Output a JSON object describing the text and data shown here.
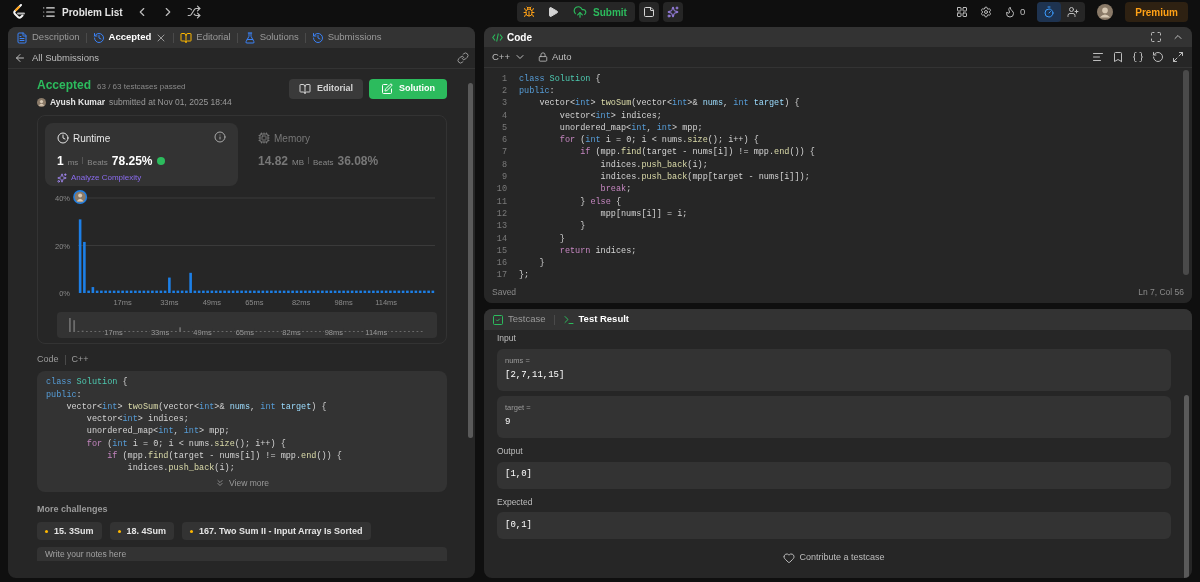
{
  "top_bar": {
    "title": "Problem List",
    "submit": "Submit",
    "streak": "0",
    "premium": "Premium"
  },
  "left_panel": {
    "tabs": [
      {
        "label": "Description",
        "selected": false,
        "closable": false
      },
      {
        "label": "Accepted",
        "selected": true,
        "closable": true
      },
      {
        "label": "Editorial",
        "selected": false,
        "closable": false
      },
      {
        "label": "Solutions",
        "selected": false,
        "closable": false
      },
      {
        "label": "Submissions",
        "selected": false,
        "closable": false
      }
    ],
    "back_link": "All Submissions",
    "status": "Accepted",
    "testcases": "63 / 63 testcases passed",
    "author": "Ayush Kumar",
    "submitted": "submitted at Nov 01, 2025 18:44",
    "editorial_button": "Editorial",
    "solution_button": "Solution",
    "runtime": {
      "title": "Runtime",
      "value": "1",
      "unit": "ms",
      "beats_label": "Beats",
      "beats": "78.25%",
      "analyze": "Analyze Complexity",
      "selected": true
    },
    "memory": {
      "title": "Memory",
      "value": "14.82",
      "unit": "MB",
      "beats_label": "Beats",
      "beats": "36.08%",
      "selected": false
    },
    "chart_data": {
      "type": "bar",
      "ylim": [
        0,
        40
      ],
      "yticks": [
        {
          "value": 0,
          "label": "0%"
        },
        {
          "value": 20,
          "label": "20%"
        },
        {
          "value": 40,
          "label": "40%"
        }
      ],
      "categories": [
        null,
        null,
        null,
        null,
        null,
        null,
        null,
        null,
        null,
        null,
        "17ms",
        null,
        null,
        null,
        null,
        null,
        null,
        null,
        null,
        null,
        null,
        "33ms",
        null,
        null,
        null,
        null,
        null,
        null,
        null,
        null,
        null,
        "49ms",
        null,
        null,
        null,
        null,
        null,
        null,
        null,
        null,
        null,
        "65ms",
        null,
        null,
        null,
        null,
        null,
        null,
        null,
        null,
        null,
        null,
        "82ms",
        null,
        null,
        null,
        null,
        null,
        null,
        null,
        null,
        null,
        "98ms",
        null,
        null,
        null,
        null,
        null,
        null,
        null,
        null,
        null,
        "114ms",
        null,
        null,
        null,
        null,
        null,
        null,
        null,
        null,
        null,
        null,
        null
      ],
      "values": [
        31,
        21.5,
        1,
        2.5,
        1,
        1,
        1,
        1,
        1,
        1,
        1,
        1,
        1,
        1,
        1,
        1,
        1,
        1,
        1,
        1,
        1,
        6.5,
        1,
        1,
        1,
        1,
        8.5,
        1,
        1,
        1,
        1,
        1,
        1,
        1,
        1,
        1,
        1,
        1,
        1,
        1,
        1,
        1,
        1,
        1,
        1,
        1,
        1,
        1,
        1,
        1,
        1,
        1,
        1,
        1,
        1,
        1,
        1,
        1,
        1,
        1,
        1,
        1,
        1,
        1,
        1,
        1,
        1,
        1,
        1,
        1,
        1,
        1,
        1,
        1,
        1,
        1,
        1,
        1,
        1,
        1,
        1,
        1,
        1,
        1
      ]
    },
    "brush_labels": [
      "17ms",
      "33ms",
      "49ms",
      "65ms",
      "82ms",
      "98ms",
      "114ms"
    ],
    "code_label": "Code",
    "language": "C++",
    "code_lines": [
      [
        {
          "text": "class ",
          "kind": "k"
        },
        {
          "text": "Solution",
          "kind": "t"
        },
        {
          "text": " {",
          "kind": "p"
        }
      ],
      [
        {
          "text": "public",
          "kind": "k"
        },
        {
          "text": ":",
          "kind": "p"
        }
      ],
      [
        {
          "text": "    vector<",
          "kind": "p"
        },
        {
          "text": "int",
          "kind": "k"
        },
        {
          "text": "> ",
          "kind": "p"
        },
        {
          "text": "twoSum",
          "kind": "f"
        },
        {
          "text": "(vector<",
          "kind": "p"
        },
        {
          "text": "int",
          "kind": "k"
        },
        {
          "text": ">& ",
          "kind": "p"
        },
        {
          "text": "nums",
          "kind": "v"
        },
        {
          "text": ", ",
          "kind": "p"
        },
        {
          "text": "int ",
          "kind": "k"
        },
        {
          "text": "target",
          "kind": "v"
        },
        {
          "text": ") {",
          "kind": "p"
        }
      ],
      [
        {
          "text": "        vector<",
          "kind": "p"
        },
        {
          "text": "int",
          "kind": "k"
        },
        {
          "text": "> indices;",
          "kind": "p"
        }
      ],
      [
        {
          "text": "        unordered_map<",
          "kind": "p"
        },
        {
          "text": "int",
          "kind": "k"
        },
        {
          "text": ", ",
          "kind": "p"
        },
        {
          "text": "int",
          "kind": "k"
        },
        {
          "text": "> mpp;",
          "kind": "p"
        }
      ],
      [
        {
          "text": "        for",
          "kind": "c"
        },
        {
          "text": " (",
          "kind": "p"
        },
        {
          "text": "int",
          "kind": "k"
        },
        {
          "text": " i = 0; i < nums.",
          "kind": "p"
        },
        {
          "text": "size",
          "kind": "f"
        },
        {
          "text": "(); i++) {",
          "kind": "p"
        }
      ],
      [
        {
          "text": "            if",
          "kind": "c"
        },
        {
          "text": " (mpp.",
          "kind": "p"
        },
        {
          "text": "find",
          "kind": "f"
        },
        {
          "text": "(target - nums[i]) != mpp.",
          "kind": "p"
        },
        {
          "text": "end",
          "kind": "f"
        },
        {
          "text": "()) {",
          "kind": "p"
        }
      ],
      [
        {
          "text": "                indices.",
          "kind": "p"
        },
        {
          "text": "push_back",
          "kind": "f"
        },
        {
          "text": "(i);",
          "kind": "p"
        }
      ]
    ],
    "view_more": "View more",
    "more_challenges": "More challenges",
    "challenges": [
      {
        "label": "15. 3Sum",
        "color": "#ffb800"
      },
      {
        "label": "18. 4Sum",
        "color": "#ffb800"
      },
      {
        "label": "167. Two Sum II - Input Array Is Sorted",
        "color": "#ffb800"
      }
    ],
    "notes_placeholder": "Write your notes here"
  },
  "code_panel": {
    "title": "Code",
    "language": "C++",
    "mode": "Auto",
    "lines": [
      {
        "n": "1",
        "tokens": [
          {
            "text": "class ",
            "kind": "k"
          },
          {
            "text": "Solution",
            "kind": "t"
          },
          {
            "text": " {",
            "kind": "p"
          }
        ]
      },
      {
        "n": "2",
        "tokens": [
          {
            "text": "public",
            "kind": "k"
          },
          {
            "text": ":",
            "kind": "p"
          }
        ]
      },
      {
        "n": "3",
        "tokens": [
          {
            "text": "    vector<",
            "kind": "p"
          },
          {
            "text": "int",
            "kind": "k"
          },
          {
            "text": "> ",
            "kind": "p"
          },
          {
            "text": "twoSum",
            "kind": "f"
          },
          {
            "text": "(vector<",
            "kind": "p"
          },
          {
            "text": "int",
            "kind": "k"
          },
          {
            "text": ">& ",
            "kind": "p"
          },
          {
            "text": "nums",
            "kind": "v"
          },
          {
            "text": ", ",
            "kind": "p"
          },
          {
            "text": "int ",
            "kind": "k"
          },
          {
            "text": "target",
            "kind": "v"
          },
          {
            "text": ") {",
            "kind": "p"
          }
        ]
      },
      {
        "n": "4",
        "tokens": [
          {
            "text": "        vector<",
            "kind": "p"
          },
          {
            "text": "int",
            "kind": "k"
          },
          {
            "text": "> indices;",
            "kind": "p"
          }
        ]
      },
      {
        "n": "5",
        "tokens": [
          {
            "text": "        unordered_map<",
            "kind": "p"
          },
          {
            "text": "int",
            "kind": "k"
          },
          {
            "text": ", ",
            "kind": "p"
          },
          {
            "text": "int",
            "kind": "k"
          },
          {
            "text": "> mpp;",
            "kind": "p"
          }
        ]
      },
      {
        "n": "6",
        "tokens": [
          {
            "text": "        for",
            "kind": "c"
          },
          {
            "text": " (",
            "kind": "p"
          },
          {
            "text": "int",
            "kind": "k"
          },
          {
            "text": " i = 0; i < nums.",
            "kind": "p"
          },
          {
            "text": "size",
            "kind": "f"
          },
          {
            "text": "(); i++) {",
            "kind": "p"
          }
        ]
      },
      {
        "n": "7",
        "tokens": [
          {
            "text": "            if",
            "kind": "c"
          },
          {
            "text": " (mpp.",
            "kind": "p"
          },
          {
            "text": "find",
            "kind": "f"
          },
          {
            "text": "(target - nums[i]) != mpp.",
            "kind": "p"
          },
          {
            "text": "end",
            "kind": "f"
          },
          {
            "text": "()) {",
            "kind": "p"
          }
        ]
      },
      {
        "n": "8",
        "tokens": [
          {
            "text": "                indices.",
            "kind": "p"
          },
          {
            "text": "push_back",
            "kind": "f"
          },
          {
            "text": "(i);",
            "kind": "p"
          }
        ]
      },
      {
        "n": "9",
        "tokens": [
          {
            "text": "                indices.",
            "kind": "p"
          },
          {
            "text": "push_back",
            "kind": "f"
          },
          {
            "text": "(mpp[target - nums[i]]);",
            "kind": "p"
          }
        ]
      },
      {
        "n": "10",
        "tokens": [
          {
            "text": "                break",
            "kind": "c"
          },
          {
            "text": ";",
            "kind": "p"
          }
        ]
      },
      {
        "n": "11",
        "tokens": [
          {
            "text": "            } ",
            "kind": "p"
          },
          {
            "text": "else",
            "kind": "c"
          },
          {
            "text": " {",
            "kind": "p"
          }
        ]
      },
      {
        "n": "12",
        "tokens": [
          {
            "text": "                mpp[nums[i]] = i;",
            "kind": "p"
          }
        ]
      },
      {
        "n": "13",
        "tokens": [
          {
            "text": "            }",
            "kind": "p"
          }
        ]
      },
      {
        "n": "14",
        "tokens": [
          {
            "text": "        }",
            "kind": "p"
          }
        ]
      },
      {
        "n": "15",
        "tokens": [
          {
            "text": "        return",
            "kind": "c"
          },
          {
            "text": " indices;",
            "kind": "p"
          }
        ]
      },
      {
        "n": "16",
        "tokens": [
          {
            "text": "    }",
            "kind": "p"
          }
        ]
      },
      {
        "n": "17",
        "tokens": [
          {
            "text": "};",
            "kind": "p"
          }
        ]
      }
    ],
    "status": "Saved",
    "cursor": "Ln 7, Col 56"
  },
  "test_panel": {
    "tabs": [
      {
        "label": "Testcase",
        "selected": false
      },
      {
        "label": "Test Result",
        "selected": true
      }
    ],
    "sections": [
      {
        "kind": "input",
        "title": "Input",
        "fields": [
          {
            "name": "nums =",
            "value": "[2,7,11,15]"
          },
          {
            "name": "target =",
            "value": "9"
          }
        ]
      },
      {
        "kind": "output",
        "title": "Output",
        "value": "[1,0]"
      },
      {
        "kind": "output",
        "title": "Expected",
        "value": "[0,1]"
      }
    ],
    "contribute": "Contribute a testcase"
  }
}
